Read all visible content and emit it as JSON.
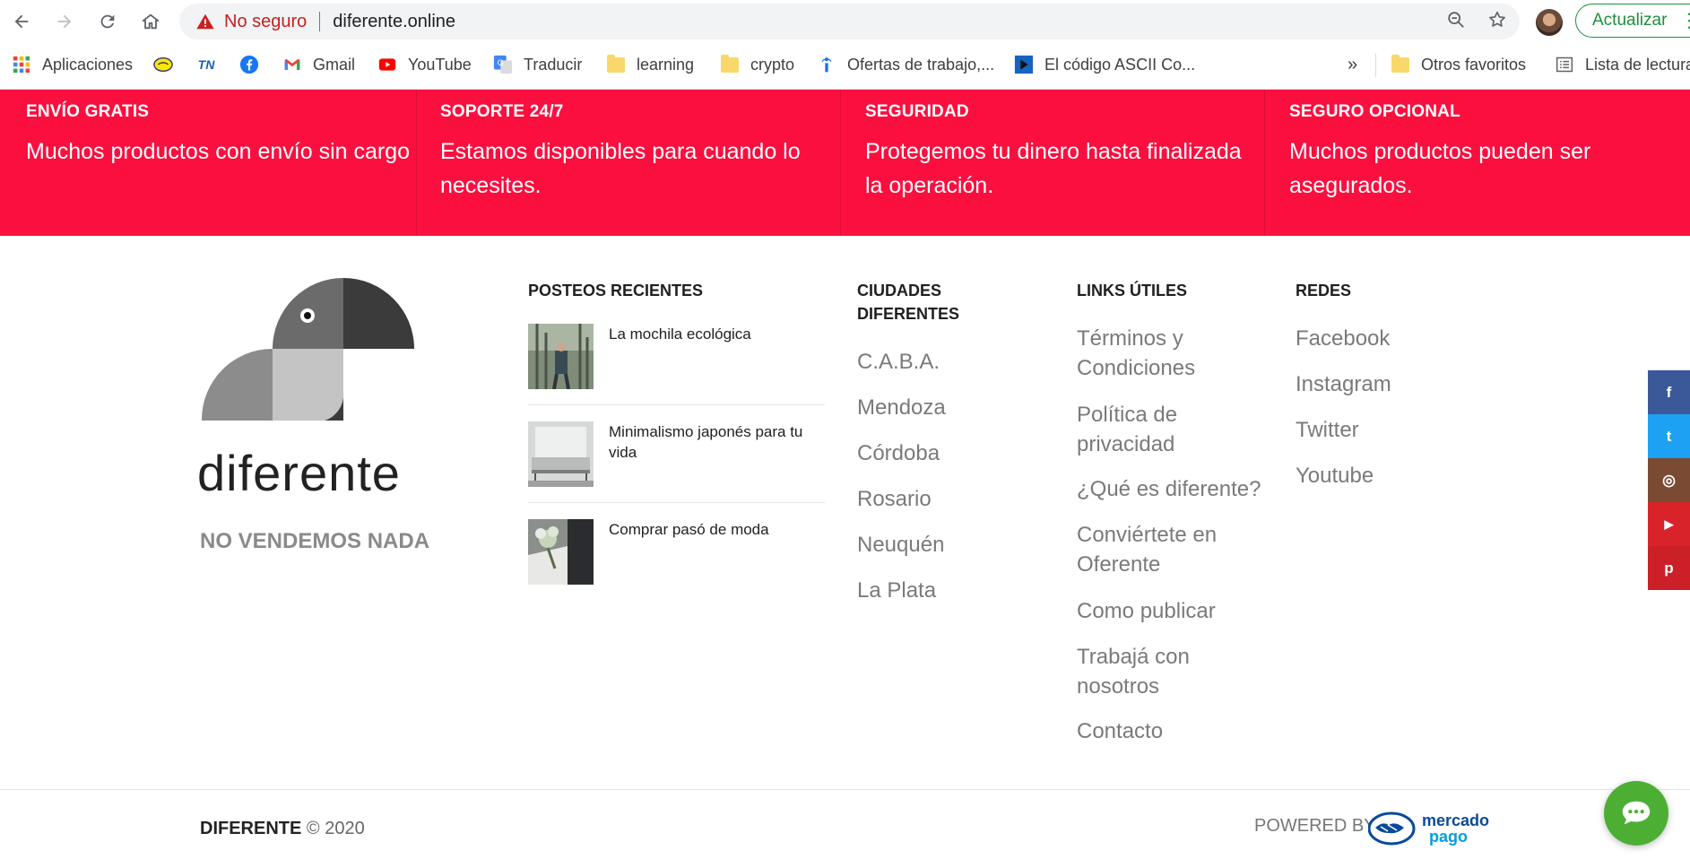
{
  "browser": {
    "security_label": "No seguro",
    "url": "diferente.online",
    "update_label": "Actualizar"
  },
  "bookmarks": {
    "items": [
      {
        "label": "Aplicaciones",
        "icon": "apps-grid-icon"
      },
      {
        "label": "",
        "icon": "mercadolibre-icon"
      },
      {
        "label": "",
        "icon": "tn-icon"
      },
      {
        "label": "",
        "icon": "facebook-icon"
      },
      {
        "label": "Gmail",
        "icon": "gmail-icon"
      },
      {
        "label": "YouTube",
        "icon": "youtube-icon"
      },
      {
        "label": "Traducir",
        "icon": "translate-icon"
      },
      {
        "label": "learning",
        "icon": "folder-icon"
      },
      {
        "label": "crypto",
        "icon": "folder-icon"
      },
      {
        "label": "Ofertas de trabajo,...",
        "icon": "info-icon"
      },
      {
        "label": "El código ASCII Co...",
        "icon": "play-icon"
      }
    ],
    "more_label": "»",
    "other_label": "Otros favoritos",
    "reading_list_label": "Lista de lectura"
  },
  "features": [
    {
      "title": "ENVÍO GRATIS",
      "text": "Muchos productos con envío sin cargo"
    },
    {
      "title": "SOPORTE 24/7",
      "text": "Estamos disponibles para cuando lo necesites."
    },
    {
      "title": "SEGURIDAD",
      "text": "Protegemos tu dinero hasta finalizada la operación."
    },
    {
      "title": "SEGURO OPCIONAL",
      "text": "Muchos productos pueden ser asegurados."
    }
  ],
  "brand": {
    "name": "diferente",
    "tagline": "NO VENDEMOS NADA"
  },
  "recent_posts": {
    "heading": "POSTEOS RECIENTES",
    "items": [
      {
        "title": "La mochila ecológica"
      },
      {
        "title": "Minimalismo japonés para tu vida"
      },
      {
        "title": "Comprar pasó de moda"
      }
    ]
  },
  "cities": {
    "heading": "CIUDADES DIFERENTES",
    "items": [
      "C.A.B.A.",
      "Mendoza",
      "Córdoba",
      "Rosario",
      "Neuquén",
      "La Plata"
    ]
  },
  "useful_links": {
    "heading": "LINKS ÚTILES",
    "items": [
      "Términos y Condiciones",
      "Política de privacidad",
      "¿Qué es diferente?",
      "Conviértete en Oferente",
      "Como publicar",
      "Trabajá con nosotros",
      "Contacto"
    ]
  },
  "social_links": {
    "heading": "REDES",
    "items": [
      "Facebook",
      "Instagram",
      "Twitter",
      "Youtube"
    ]
  },
  "footer": {
    "brand": "DIFERENTE",
    "copyright": "© 2020",
    "powered_by": "POWERED BY",
    "payment_logo_line1": "mercado",
    "payment_logo_line2": "pago"
  },
  "side_social": {
    "buttons": [
      {
        "glyph": "f",
        "icon": "facebook-share-icon",
        "color": "#3b5998"
      },
      {
        "glyph": "t",
        "icon": "twitter-share-icon",
        "color": "#1da1f2"
      },
      {
        "glyph": "◎",
        "icon": "instagram-share-icon",
        "color": "#7b4a33"
      },
      {
        "glyph": "▶",
        "icon": "youtube-share-icon",
        "color": "#d8232a"
      },
      {
        "glyph": "p",
        "icon": "pinterest-share-icon",
        "color": "#cb2027"
      }
    ]
  },
  "colors": {
    "accent_red": "#fb0f3e",
    "chat_green": "#4caf34"
  }
}
